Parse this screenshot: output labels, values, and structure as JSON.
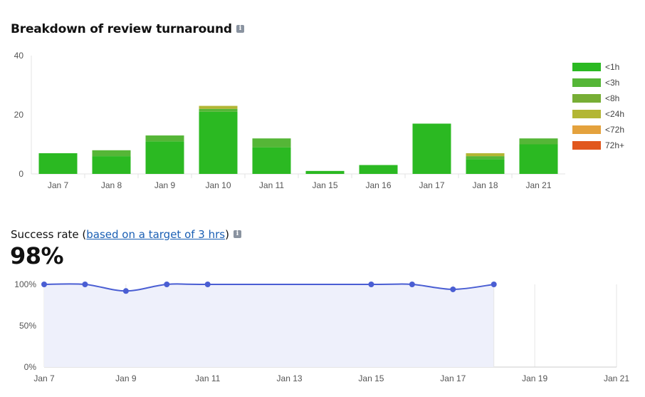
{
  "header": {
    "title": "Breakdown of review turnaround"
  },
  "success": {
    "prefix": "Success rate (",
    "link_text": "based on a target of 3 hrs",
    "suffix": ")",
    "value": "98%"
  },
  "icons": {
    "info": "info-icon"
  },
  "colors": {
    "<1h": "#2bb922",
    "<3h": "#55b637",
    "<8h": "#77ae35",
    "<24h": "#b3b634",
    "<72h": "#e4a23d",
    "72h+": "#e1571d",
    "line": "#4a5ed3",
    "area": "#eef0fb"
  },
  "chart_data": [
    {
      "type": "bar",
      "stacked": true,
      "categories": [
        "Jan 7",
        "Jan 8",
        "Jan 9",
        "Jan 10",
        "Jan 11",
        "Jan 15",
        "Jan 16",
        "Jan 17",
        "Jan 18",
        "Jan 21"
      ],
      "series": [
        {
          "name": "<1h",
          "values": [
            7,
            6,
            11,
            21,
            9,
            1,
            3,
            17,
            5,
            10
          ]
        },
        {
          "name": "<3h",
          "values": [
            0,
            2,
            2,
            1,
            3,
            0,
            0,
            0,
            1,
            2
          ]
        },
        {
          "name": "<8h",
          "values": [
            0,
            0,
            0,
            0,
            0,
            0,
            0,
            0,
            0,
            0
          ]
        },
        {
          "name": "<24h",
          "values": [
            0,
            0,
            0,
            1,
            0,
            0,
            0,
            0,
            1,
            0
          ]
        },
        {
          "name": "<72h",
          "values": [
            0,
            0,
            0,
            0,
            0,
            0,
            0,
            0,
            0,
            0
          ]
        },
        {
          "name": "72h+",
          "values": [
            0,
            0,
            0,
            0,
            0,
            0,
            0,
            0,
            0,
            0
          ]
        }
      ],
      "ylim": [
        0,
        40
      ],
      "yticks": [
        0,
        20,
        40
      ],
      "legend": "right",
      "grid": false
    },
    {
      "type": "area",
      "x": [
        "Jan 7",
        "Jan 8",
        "Jan 9",
        "Jan 10",
        "Jan 11",
        "Jan 15",
        "Jan 16",
        "Jan 17",
        "Jan 18"
      ],
      "values": [
        100,
        100,
        92,
        100,
        100,
        100,
        100,
        94,
        100
      ],
      "x_dates": [
        7,
        8,
        9,
        10,
        11,
        15,
        16,
        17,
        18
      ],
      "xlim_dates": [
        7,
        21
      ],
      "xticks": [
        "Jan 7",
        "Jan 9",
        "Jan 11",
        "Jan 13",
        "Jan 15",
        "Jan 17",
        "Jan 19",
        "Jan 21"
      ],
      "xtick_dates": [
        7,
        9,
        11,
        13,
        15,
        17,
        19,
        21
      ],
      "ylim": [
        0,
        100
      ],
      "yticks": [
        "0%",
        "50%",
        "100%"
      ],
      "ytick_values": [
        0,
        50,
        100
      ],
      "grid": true
    }
  ]
}
